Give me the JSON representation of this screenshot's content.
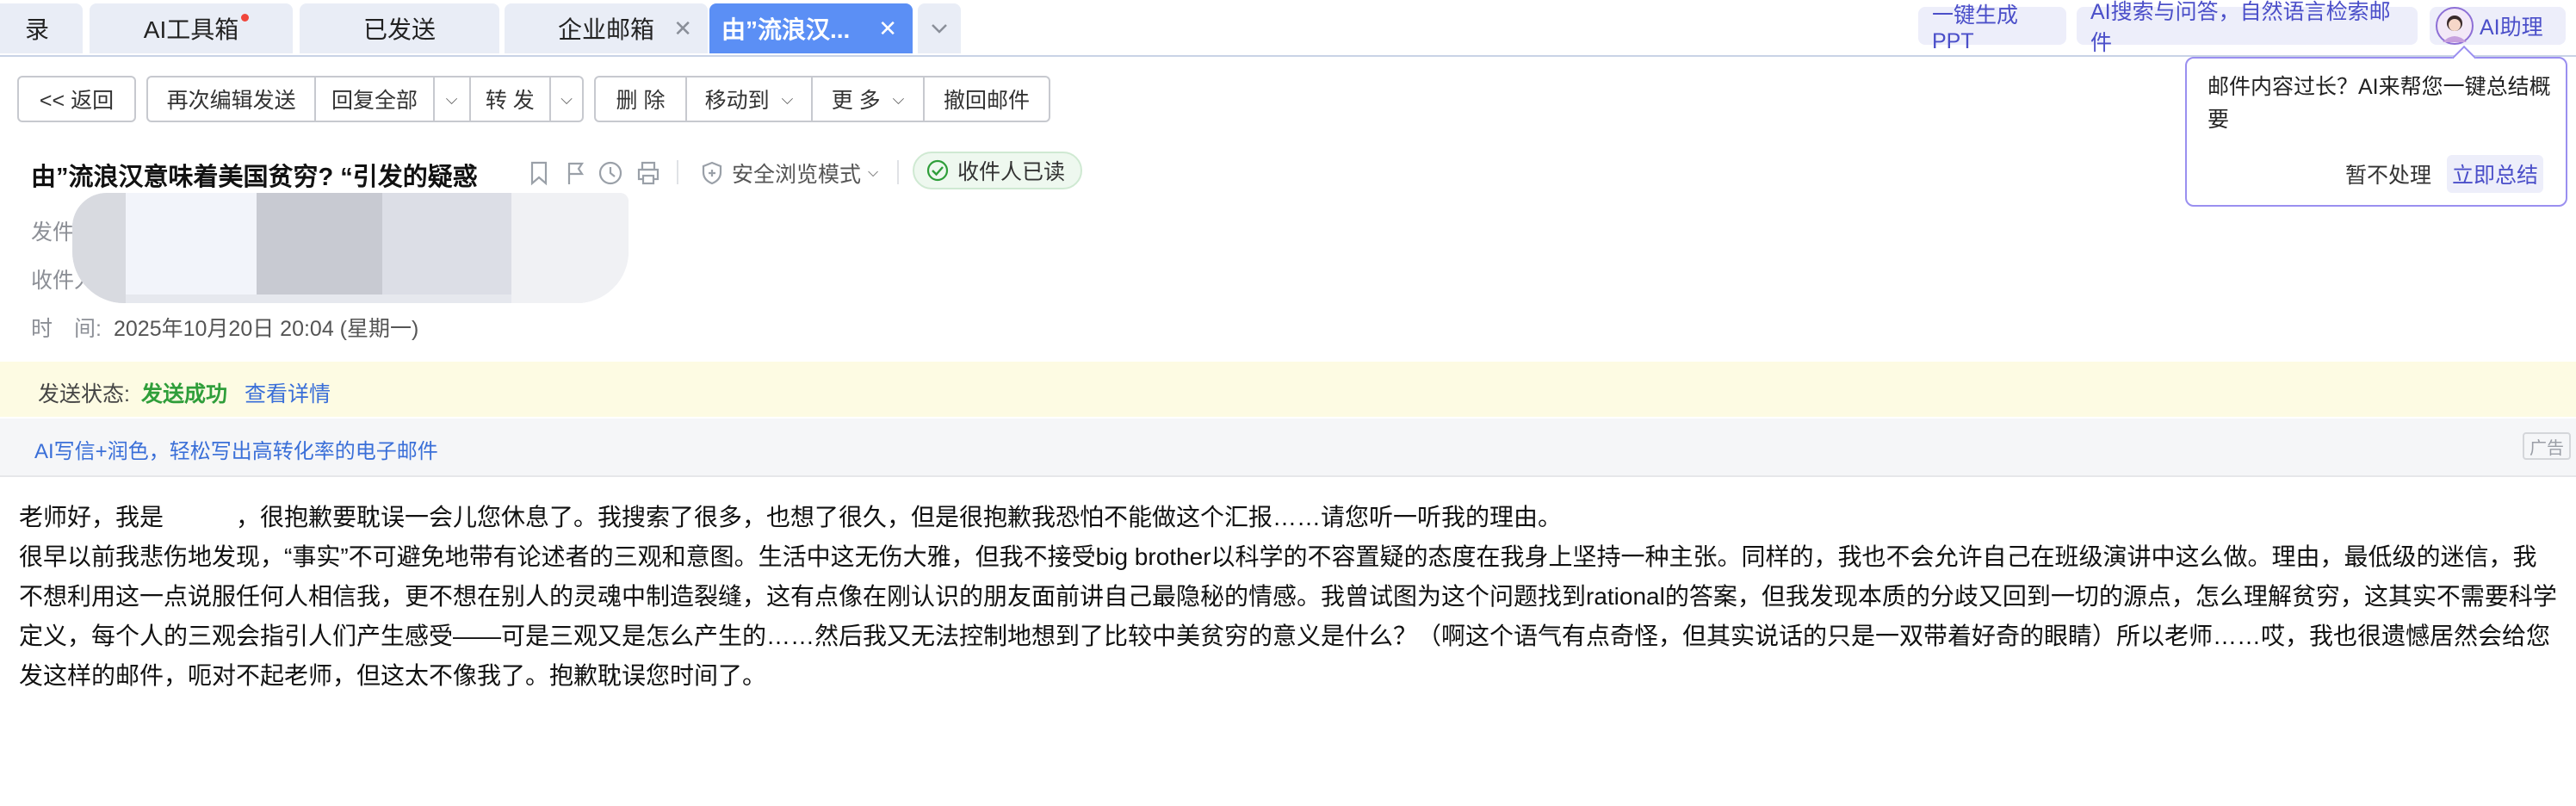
{
  "tabs": [
    {
      "label": "录"
    },
    {
      "label": "AI工具箱"
    },
    {
      "label": "已发送"
    },
    {
      "label": "企业邮箱"
    },
    {
      "label": "由”流浪汉..."
    }
  ],
  "tab_close_glyph": "✕",
  "top_actions": {
    "ppt": "一键生成PPT",
    "ai_search": "AI搜索与问答，自然语言检索邮件",
    "ai_assistant": "AI助理"
  },
  "toolbar": {
    "back": "<< 返回",
    "reedit": "再次编辑发送",
    "reply_all": "回复全部",
    "forward": "转 发",
    "delete": "删 除",
    "move_to": "移动到",
    "more": "更 多",
    "recall": "撤回邮件"
  },
  "mail": {
    "subject": "由”流浪汉意味着美国贫穷? “引发的疑惑",
    "safe_mode": "安全浏览模式",
    "read_status": "收件人已读",
    "from_label": "发件",
    "to_label": "收件人",
    "time_label": "时　间:",
    "time_value": "2025年10月20日 20:04 (星期一)"
  },
  "popover": {
    "message": "邮件内容过长？AI来帮您一键总结概要",
    "ignore": "暂不处理",
    "summarize": "立即总结"
  },
  "send_status": {
    "label": "发送状态:",
    "value": "发送成功",
    "details_link": "查看详情"
  },
  "ad": {
    "text": "AI写信+润色，轻松写出高转化率的电子邮件",
    "badge": "广告"
  },
  "body": {
    "paragraph1": "老师好，我是　　　，很抱歉要耽误一会儿您休息了。我搜索了很多，也想了很久，但是很抱歉我恐怕不能做这个汇报……请您听一听我的理由。",
    "paragraph2": "很早以前我悲伤地发现，“事实”不可避免地带有论述者的三观和意图。生活中这无伤大雅，但我不接受big brother以科学的不容置疑的态度在我身上坚持一种主张。同样的，我也不会允许自己在班级演讲中这么做。理由，最低级的迷信，我不想利用这一点说服任何人相信我，更不想在别人的灵魂中制造裂缝，这有点像在刚认识的朋友面前讲自己最隐秘的情感。我曾试图为这个问题找到rational的答案，但我发现本质的分歧又回到一切的源点，怎么理解贫穷，这其实不需要科学定义，每个人的三观会指引人们产生感受——可是三观又是怎么产生的……然后我又无法控制地想到了比较中美贫穷的意义是什么？（啊这个语气有点奇怪，但其实说话的只是一双带着好奇的眼睛）所以老师……哎，我也很遗憾居然会给您发这样的邮件，呃对不起老师，但这太不像我了。抱歉耽误您时间了。"
  },
  "colors": {
    "accent_tab": "#5b8ff5",
    "ai_purple": "#4b4fc9",
    "success_green": "#2f9e3a",
    "link_blue": "#3a6fd8",
    "status_band": "#fdfbe3"
  }
}
